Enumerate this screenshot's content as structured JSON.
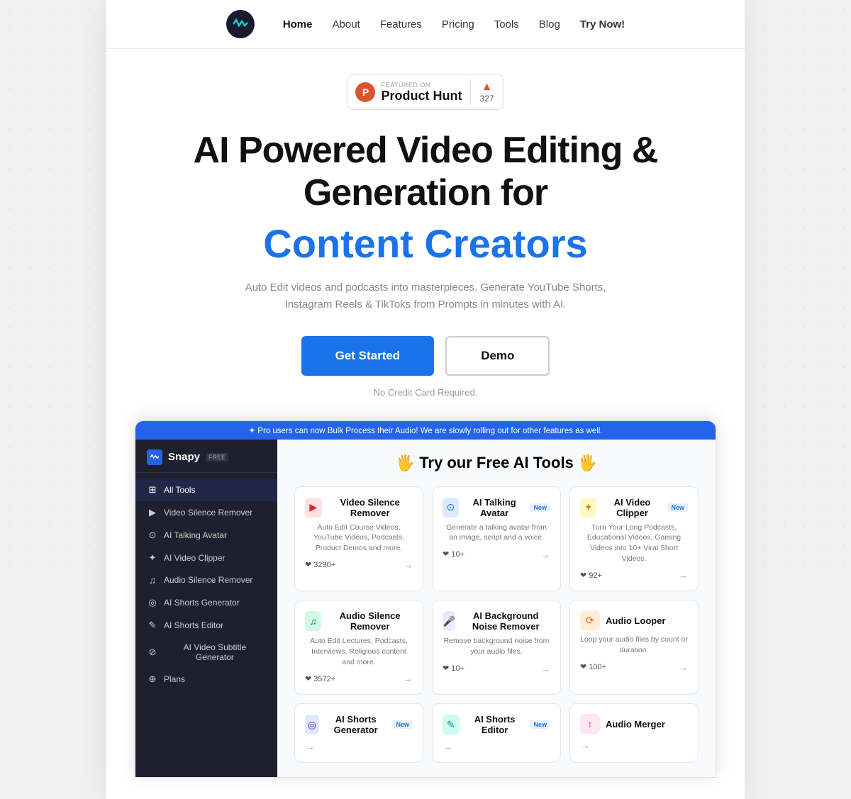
{
  "nav": {
    "links": [
      {
        "label": "Home",
        "active": true
      },
      {
        "label": "About",
        "active": false
      },
      {
        "label": "Features",
        "active": false
      },
      {
        "label": "Pricing",
        "active": false
      },
      {
        "label": "Tools",
        "active": false
      },
      {
        "label": "Blog",
        "active": false
      },
      {
        "label": "Try Now!",
        "active": false
      }
    ]
  },
  "product_hunt": {
    "featured_label": "FEATURED ON",
    "name": "Product Hunt",
    "upvote_count": "327"
  },
  "hero": {
    "headline_line1": "AI Powered Video Editing &",
    "headline_line2": "Generation for",
    "headline_blue": "Content Creators",
    "subheadline": "Auto Edit videos and podcasts into masterpieces. Generate YouTube Shorts, Instagram Reels & TikToks from Prompts in minutes with AI.",
    "cta_primary": "Get Started",
    "cta_secondary": "Demo",
    "no_cc": "No Credit Card Required."
  },
  "app": {
    "topbar": "✦ Pro users can now Bulk Process their Audio! We are slowly rolling out for other features as well.",
    "brand": "Snapy",
    "brand_badge": "FREE",
    "main_title": "🖐 Try our Free AI Tools 🖐",
    "sidebar_items": [
      {
        "icon": "⊞",
        "label": "All Tools",
        "active": true
      },
      {
        "icon": "▶",
        "label": "Video Silence Remover",
        "active": false
      },
      {
        "icon": "⊙",
        "label": "AI Talking Avatar",
        "active": false
      },
      {
        "icon": "✦",
        "label": "AI Video Clipper",
        "active": false
      },
      {
        "icon": "♫",
        "label": "Audio Silence Remover",
        "active": false
      },
      {
        "icon": "◎",
        "label": "AI Shorts Generator",
        "active": false
      },
      {
        "icon": "✎",
        "label": "AI Shorts Editor",
        "active": false
      },
      {
        "icon": "⊘",
        "label": "AI Video Subtitle Generator",
        "active": false
      },
      {
        "icon": "⊕",
        "label": "Plans",
        "active": false
      }
    ],
    "tools": [
      {
        "icon": "▶",
        "icon_color": "red",
        "title": "Video Silence Remover",
        "badge": null,
        "desc": "Auto Edit Course Videos, YouTube Videos, Podcasts, Product Demos and more.",
        "likes": "❤ 3290+"
      },
      {
        "icon": "⊙",
        "icon_color": "blue",
        "title": "AI Talking Avatar",
        "badge": "New",
        "desc": "Generate a talking avatar from an image, script and a voice.",
        "likes": "❤ 10+"
      },
      {
        "icon": "✦",
        "icon_color": "yellow",
        "title": "AI Video Clipper",
        "badge": "New",
        "desc": "Turn Your Long Podcasts, Educational Videos, Gaming Videos into 10+ Viral Short Videos.",
        "likes": "❤ 92+"
      },
      {
        "icon": "♫",
        "icon_color": "green",
        "title": "Audio Silence Remover",
        "badge": null,
        "desc": "Auto Edit Lectures, Podcasts, Interviews, Religious content and more.",
        "likes": "❤ 3572+"
      },
      {
        "icon": "🎤",
        "icon_color": "purple",
        "title": "AI Background Noise Remover",
        "badge": null,
        "desc": "Remove background noise from your audio files.",
        "likes": "❤ 10+"
      },
      {
        "icon": "⟳",
        "icon_color": "orange",
        "title": "Audio Looper",
        "badge": null,
        "desc": "Loop your audio files by count or duration.",
        "likes": "❤ 100+"
      },
      {
        "icon": "◎",
        "icon_color": "indigo",
        "title": "AI Shorts Generator",
        "badge": "New",
        "desc": "",
        "likes": ""
      },
      {
        "icon": "✎",
        "icon_color": "teal",
        "title": "AI Shorts Editor",
        "badge": "New",
        "desc": "",
        "likes": ""
      },
      {
        "icon": "↑",
        "icon_color": "pink",
        "title": "Audio Merger",
        "badge": null,
        "desc": "",
        "likes": ""
      }
    ]
  }
}
